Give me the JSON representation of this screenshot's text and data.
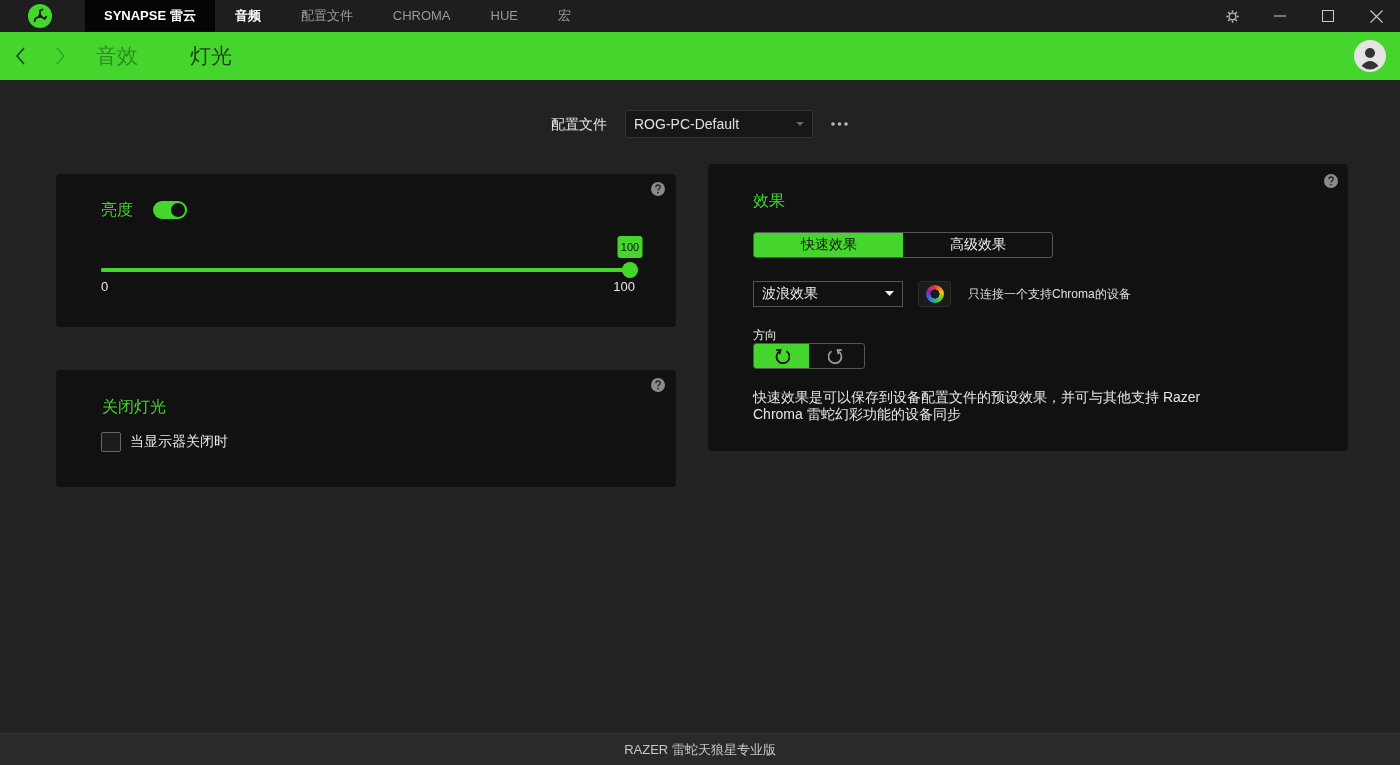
{
  "title_bar": {
    "home_tab": "SYNAPSE 雷云",
    "tabs": [
      {
        "label": "音频",
        "selected": true
      },
      {
        "label": "配置文件",
        "selected": false
      },
      {
        "label": "CHROMA",
        "selected": false
      },
      {
        "label": "HUE",
        "selected": false
      },
      {
        "label": "宏",
        "selected": false
      }
    ]
  },
  "nav_bar": {
    "back": {
      "disabled": false
    },
    "forward": {
      "disabled": true
    },
    "tabs": [
      {
        "label": "音效",
        "selected": false
      },
      {
        "label": "灯光",
        "selected": true
      }
    ]
  },
  "profile": {
    "label": "配置文件",
    "value": "ROG-PC-Default"
  },
  "brightness": {
    "title": "亮度",
    "on": true,
    "slider": {
      "level": 1,
      "bubble": "100",
      "min_label": "0",
      "max_label": "100"
    }
  },
  "lights_off": {
    "title": "关闭灯光",
    "option": {
      "label": "当显示器关闭时",
      "checked": false
    }
  },
  "effects": {
    "title": "效果",
    "modes": [
      {
        "label": "快速效果",
        "selected": true
      },
      {
        "label": "高级效果",
        "selected": false
      }
    ],
    "effect": {
      "value": "波浪效果"
    },
    "device_note": "只连接一个支持Chroma的设备",
    "direction": {
      "label": "方向",
      "options": [
        {
          "kind": "clockwise",
          "selected": true
        },
        {
          "kind": "counterclockwise",
          "selected": false
        }
      ]
    },
    "description": "快速效果是可以保存到设备配置文件的预设效果，并可与其他支持 Razer Chroma 雷蛇幻彩功能的设备同步"
  },
  "footer": {
    "device_name": "RAZER 雷蛇天狼星专业版"
  }
}
